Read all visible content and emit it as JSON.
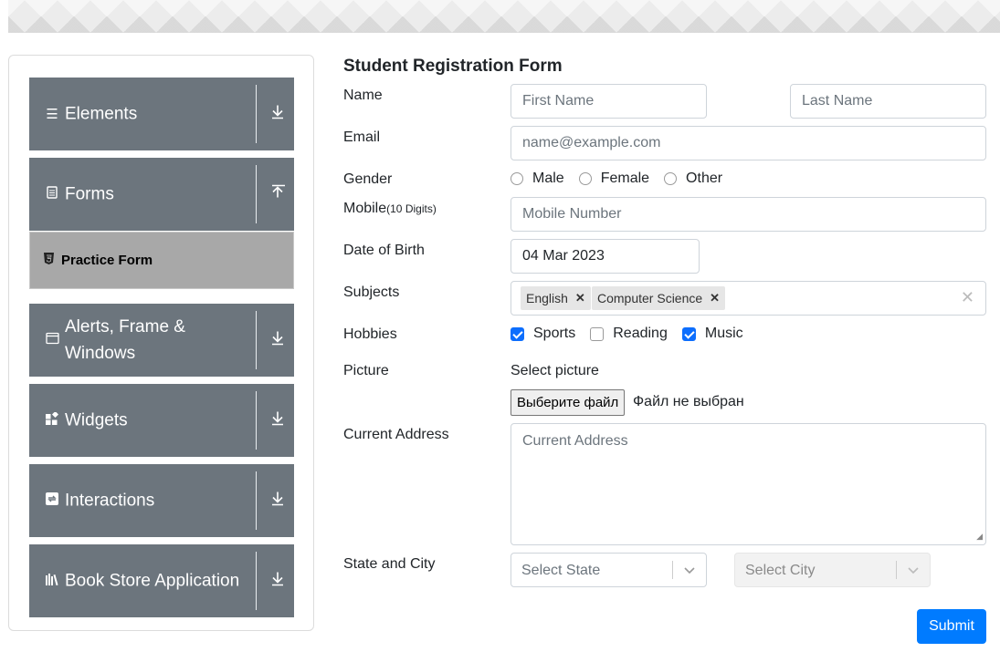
{
  "sidebar": {
    "groups": [
      {
        "label": "Elements",
        "icon": "hamburger-icon"
      },
      {
        "label": "Forms",
        "icon": "document-icon"
      },
      {
        "label": "Alerts, Frame & Windows",
        "icon": "window-icon"
      },
      {
        "label": "Widgets",
        "icon": "widgets-icon"
      },
      {
        "label": "Interactions",
        "icon": "interactions-icon"
      },
      {
        "label": "Book Store Application",
        "icon": "books-icon"
      }
    ],
    "active_item": {
      "label": "Practice Form",
      "icon": "html5-icon"
    }
  },
  "form": {
    "title": "Student Registration Form",
    "name_label": "Name",
    "first_name_placeholder": "First Name",
    "last_name_placeholder": "Last Name",
    "email_label": "Email",
    "email_placeholder": "name@example.com",
    "gender_label": "Gender",
    "gender_options": [
      "Male",
      "Female",
      "Other"
    ],
    "mobile_label": "Mobile",
    "mobile_hint": "(10 Digits)",
    "mobile_placeholder": "Mobile Number",
    "dob_label": "Date of Birth",
    "dob_value": "04 Mar 2023",
    "subjects_label": "Subjects",
    "subjects": [
      "English",
      "Computer Science"
    ],
    "hobbies_label": "Hobbies",
    "hobbies": [
      {
        "label": "Sports",
        "checked": true
      },
      {
        "label": "Reading",
        "checked": false
      },
      {
        "label": "Music",
        "checked": true
      }
    ],
    "picture_label": "Picture",
    "picture_prompt": "Select picture",
    "file_button": "Выберите файл",
    "file_status": "Файл не выбран",
    "address_label": "Current Address",
    "address_placeholder": "Current Address",
    "state_city_label": "State and City",
    "state_placeholder": "Select State",
    "city_placeholder": "Select City",
    "submit_label": "Submit"
  },
  "colors": {
    "sidebar_group_bg": "#6c757d",
    "active_item_bg": "#a8a8a8",
    "accent": "#007bff",
    "checkbox_checked": "#0d6efd"
  }
}
